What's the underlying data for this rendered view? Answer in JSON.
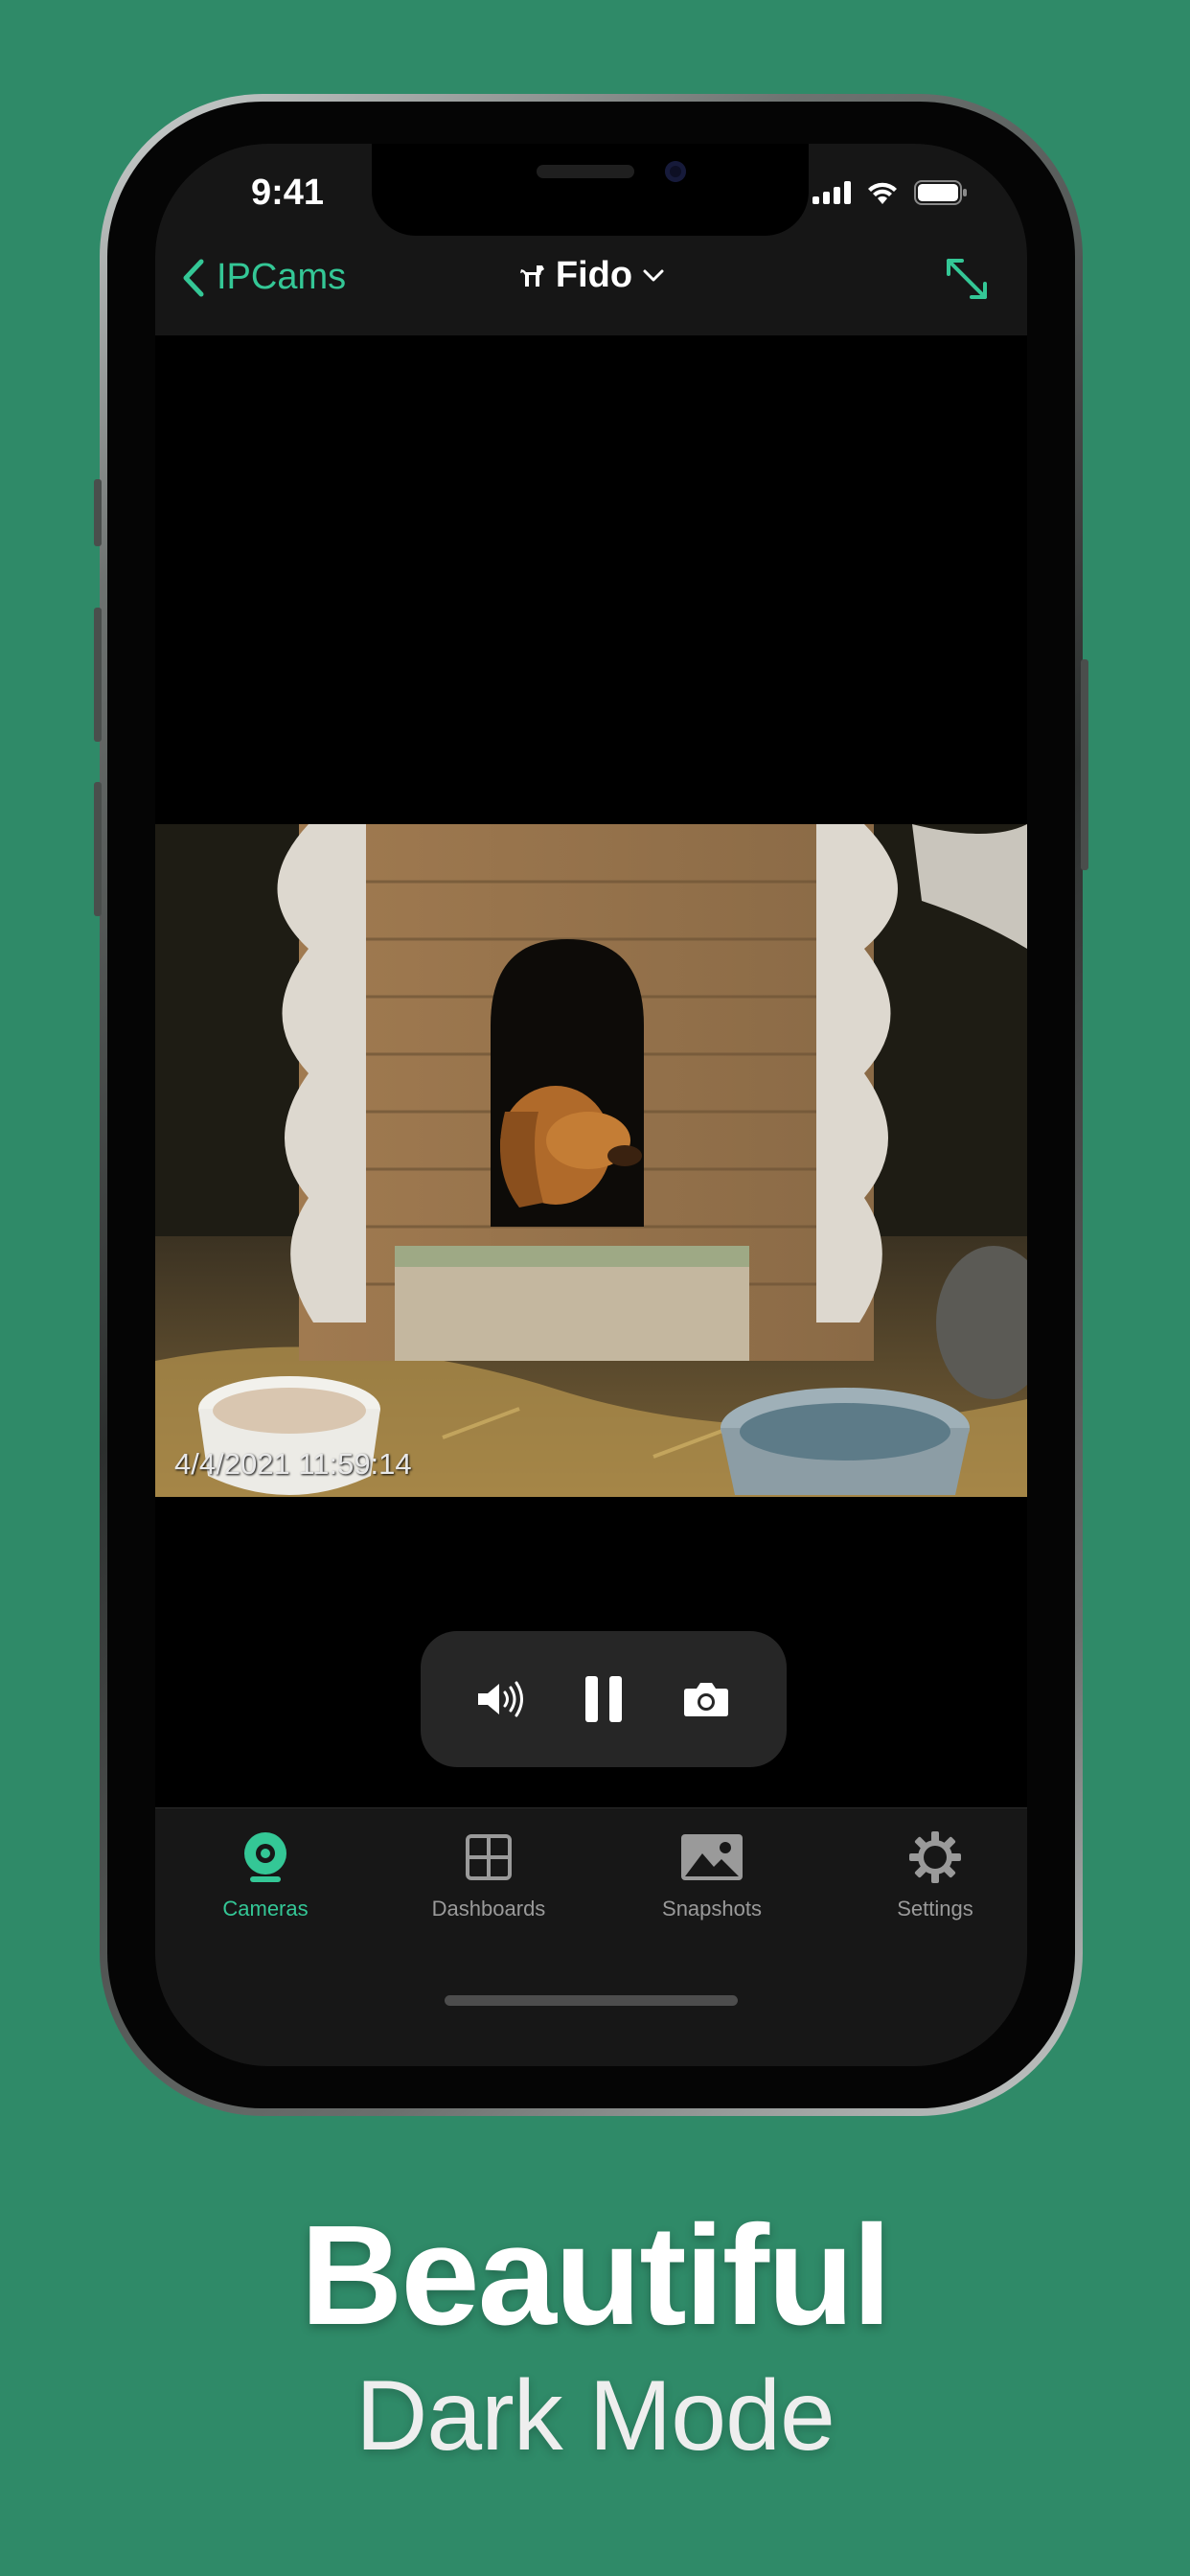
{
  "status_bar": {
    "time": "9:41"
  },
  "nav": {
    "back_label": "IPCams",
    "title": "Fido"
  },
  "video": {
    "timestamp": "4/4/2021 11:59:14"
  },
  "tabs": [
    {
      "label": "Cameras",
      "active": true
    },
    {
      "label": "Dashboards",
      "active": false
    },
    {
      "label": "Snapshots",
      "active": false
    },
    {
      "label": "Settings",
      "active": false
    }
  ],
  "marketing": {
    "headline": "Beautiful",
    "subline": "Dark Mode"
  },
  "colors": {
    "accent": "#34c796",
    "background": "#2f8a68",
    "tab_inactive": "#9a9a9a"
  }
}
